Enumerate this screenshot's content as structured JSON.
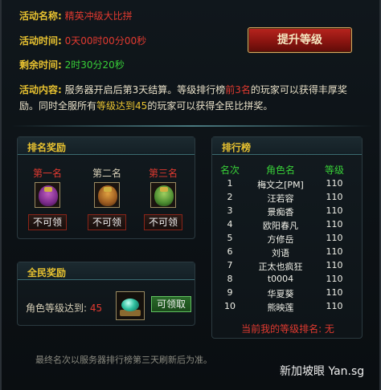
{
  "event": {
    "name_label": "活动名称:",
    "name_value": "精英冲级大比拼",
    "time_label": "活动时间:",
    "time_value": "0天00时00分00秒",
    "remain_label": "剩余时间:",
    "remain_value": "2时30分20秒",
    "content_label": "活动内容:",
    "content_parts": {
      "p1": "服务器开启后第3天结算。等级排行榜",
      "p2": "前3名",
      "p3": "的玩家可以获得丰厚奖励。同时全服所有",
      "p4": "等级达到",
      "p5": "45",
      "p6": "的玩家可以获得全民比拼奖。"
    },
    "upgrade_button": "提升等级"
  },
  "rank_reward": {
    "title": "排名奖励",
    "slots": [
      {
        "label": "第一名",
        "button": "不可领"
      },
      {
        "label": "第二名",
        "button": "不可领"
      },
      {
        "label": "第三名",
        "button": "不可领"
      }
    ]
  },
  "all_reward": {
    "title": "全民奖励",
    "level_label": "角色等级达到:",
    "level_value": "45",
    "button": "可领取"
  },
  "leaderboard": {
    "title": "排行榜",
    "headers": {
      "rank": "名次",
      "name": "角色名",
      "level": "等级"
    },
    "rows": [
      {
        "rank": "1",
        "name": "梅文之[PM]",
        "level": "110"
      },
      {
        "rank": "2",
        "name": "汪若容",
        "level": "110"
      },
      {
        "rank": "3",
        "name": "景痴香",
        "level": "110"
      },
      {
        "rank": "4",
        "name": "欧阳春凡",
        "level": "110"
      },
      {
        "rank": "5",
        "name": "方修岳",
        "level": "110"
      },
      {
        "rank": "6",
        "name": "刘语",
        "level": "110"
      },
      {
        "rank": "7",
        "name": "正太也疯狂",
        "level": "110"
      },
      {
        "rank": "8",
        "name": "t0004",
        "level": "110"
      },
      {
        "rank": "9",
        "name": "华夏葵",
        "level": "110"
      },
      {
        "rank": "10",
        "name": "熊映莲",
        "level": "110"
      }
    ],
    "my_rank": "当前我的等级排名: 无"
  },
  "footer": "最终名次以服务器排行榜第三天刷新后为准。",
  "watermark": "新加坡眼 Yan.sg"
}
